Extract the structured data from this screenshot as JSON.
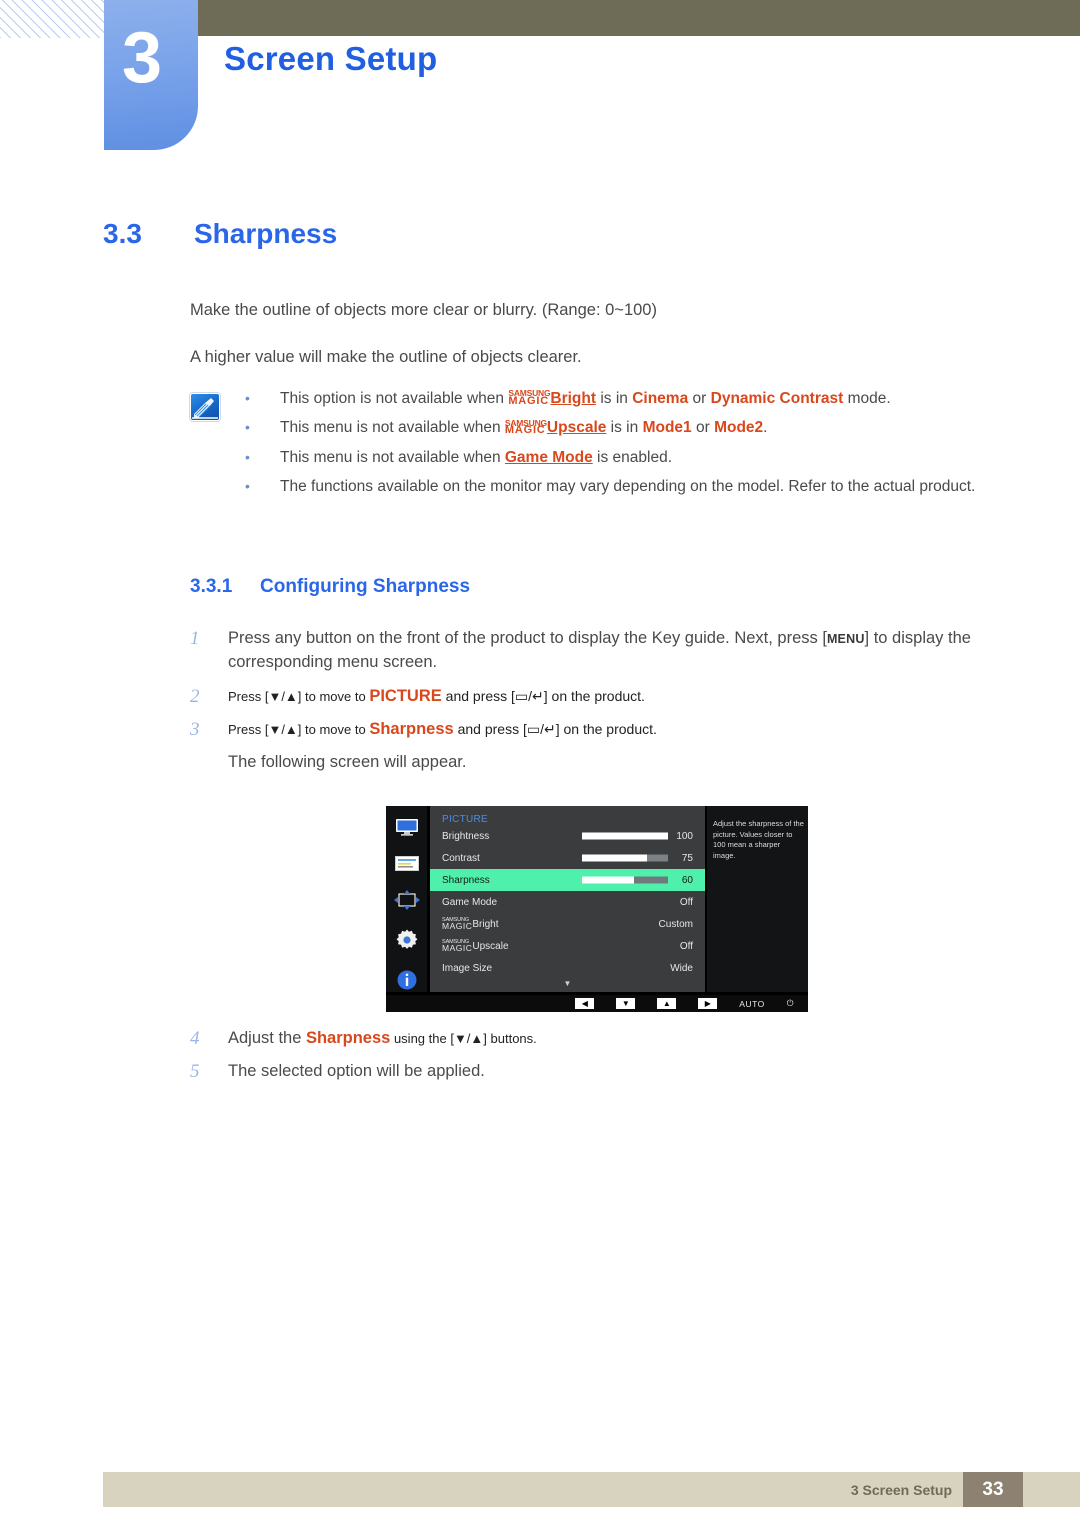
{
  "header": {
    "chapter_number": "3",
    "chapter_title": "Screen Setup"
  },
  "section": {
    "number": "3.3",
    "title": "Sharpness",
    "paragraph_1": "Make the outline of objects more clear or blurry. (Range: 0~100)",
    "paragraph_2": "A higher value will make the outline of objects clearer."
  },
  "note": {
    "icon": "note-pen-icon",
    "items": [
      {
        "pre": "This option is not available when ",
        "magic_top": "SAMSUNG",
        "magic_bottom": "MAGIC",
        "magic_suffix": "Bright",
        "mid": " is in ",
        "hl1": "Cinema",
        "conj": " or ",
        "hl2": "Dynamic Contrast",
        "post": " mode."
      },
      {
        "pre": "This menu is not available when ",
        "magic_top": "SAMSUNG",
        "magic_bottom": "MAGIC",
        "magic_suffix": "Upscale",
        "mid": " is in ",
        "hl1": "Mode1",
        "conj": " or ",
        "hl2": "Mode2",
        "post": "."
      },
      {
        "pre": "This menu is not available when ",
        "hl1": "Game Mode",
        "post": " is enabled."
      },
      {
        "pre": "The functions available on the monitor may vary depending on the model. Refer to the actual product."
      }
    ]
  },
  "subsection": {
    "number": "3.3.1",
    "title": "Configuring Sharpness"
  },
  "steps": [
    {
      "num": "1",
      "pre": "Press any button on the front of the product to display the Key guide. Next, press [",
      "key": "MENU",
      "post": "] to display the corresponding menu screen."
    },
    {
      "num": "2",
      "pre": "Press [▼/▲] to move to ",
      "hl": "PICTURE",
      "post": " and press [▭/↵] on the product."
    },
    {
      "num": "3",
      "pre": "Press [▼/▲] to move to ",
      "hl": "Sharpness",
      "post": " and press [▭/↵] on the product.",
      "follow": "The following screen will appear."
    },
    {
      "num": "4",
      "pre": "Adjust the ",
      "hl": "Sharpness",
      "post": " using the [▼/▲] buttons."
    },
    {
      "num": "5",
      "pre": "The selected option will be applied."
    }
  ],
  "osd": {
    "title": "PICTURE",
    "sidebar_icons": [
      "monitor-icon",
      "osd-panel-icon",
      "position-arrows-icon",
      "gear-icon",
      "info-icon"
    ],
    "rows": [
      {
        "label": "Brightness",
        "value": "100",
        "bar": 100
      },
      {
        "label": "Contrast",
        "value": "75",
        "bar": 75
      },
      {
        "label": "Sharpness",
        "value": "60",
        "bar": 60,
        "selected": true
      },
      {
        "label": "Game Mode",
        "value": "Off"
      },
      {
        "label_magic_top": "SAMSUNG",
        "label_magic_bottom": "MAGIC",
        "label_suffix": "Bright",
        "value": "Custom"
      },
      {
        "label_magic_top": "SAMSUNG",
        "label_magic_bottom": "MAGIC",
        "label_suffix": "Upscale",
        "value": "Off"
      },
      {
        "label": "Image Size",
        "value": "Wide"
      }
    ],
    "scroll_caret": "▼",
    "tip": "Adjust the sharpness of the picture. Values closer to 100 mean a sharper image.",
    "buttons": [
      "◀",
      "▼",
      "▲",
      "▶"
    ],
    "auto_label": "AUTO",
    "power_icon": "⏻",
    "highlight_color": "#4ef0ab"
  },
  "footer": {
    "label": "3 Screen Setup",
    "page": "33"
  }
}
